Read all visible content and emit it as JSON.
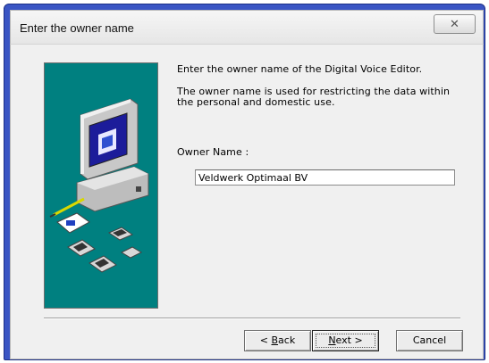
{
  "window": {
    "title": "Enter the owner name",
    "close_icon": "close-icon"
  },
  "content": {
    "intro": "Enter the owner name of the Digital Voice Editor.",
    "description_line1": "The owner name is used for restricting the data within",
    "description_line2": "the personal and domestic use.",
    "owner_label": "Owner Name :",
    "owner_value": "Veldwerk Optimaal BV"
  },
  "buttons": {
    "back_accel": "B",
    "back_rest": "ack",
    "back_prefix": "< ",
    "next_accel": "N",
    "next_rest": "ext >",
    "cancel": "Cancel"
  },
  "colors": {
    "panel": "#008080",
    "frame": "#3a55c4"
  }
}
